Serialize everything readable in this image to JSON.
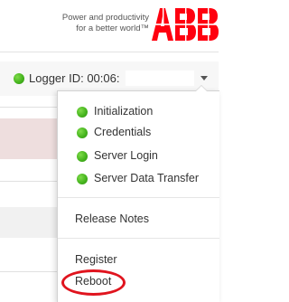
{
  "header": {
    "tagline_line1": "Power and productivity",
    "tagline_line2": "for a better world™",
    "brand_color": "#ff000f"
  },
  "logger": {
    "label": "Logger ID: 00:06:",
    "status_color": "#46b51e"
  },
  "menu": {
    "items": [
      {
        "label": "Initialization",
        "status": "green"
      },
      {
        "label": "Credentials",
        "status": "green"
      },
      {
        "label": "Server Login",
        "status": "green"
      },
      {
        "label": "Server Data Transfer",
        "status": "green"
      },
      {
        "label": "Release Notes"
      },
      {
        "label": "Register"
      },
      {
        "label": "Reboot",
        "highlighted": true
      }
    ],
    "highlight_color": "#e0141e"
  }
}
